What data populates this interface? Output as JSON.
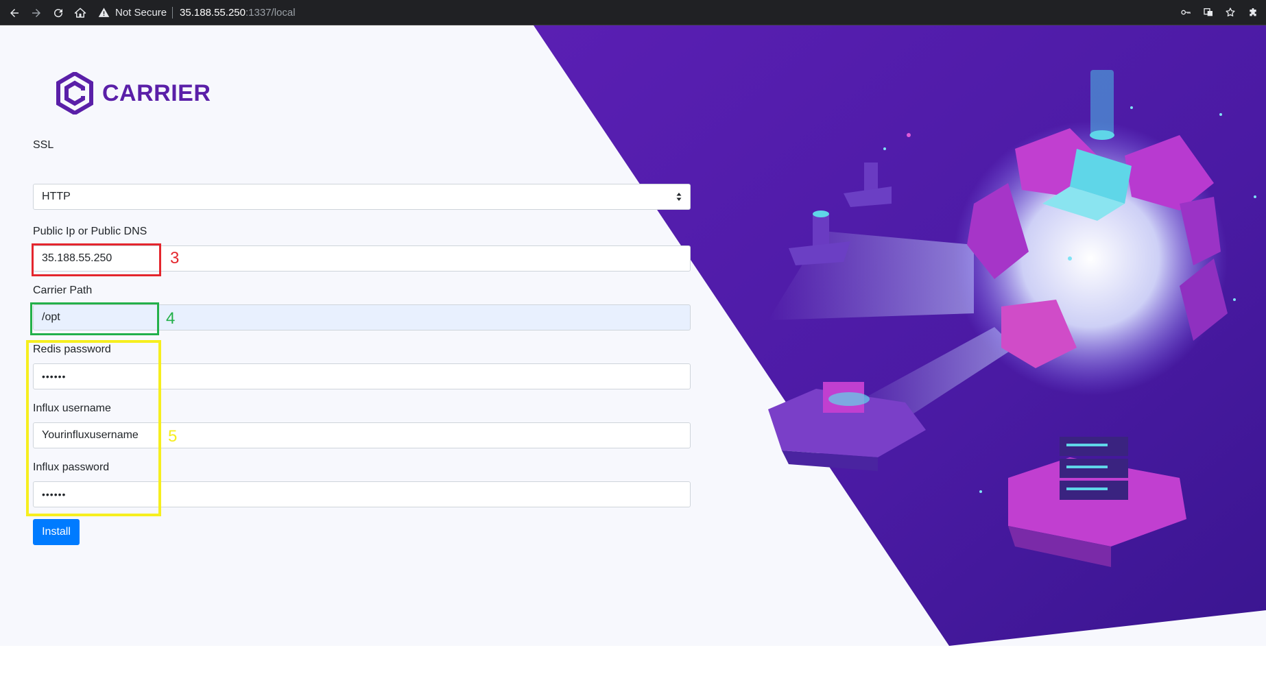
{
  "browser": {
    "not_secure_label": "Not Secure",
    "url_host": "35.188.55.250",
    "url_path": ":1337/local"
  },
  "brand": {
    "name": "CARRIER",
    "color": "#5a1fa8"
  },
  "form": {
    "ssl": {
      "label": "SSL",
      "value": "HTTP"
    },
    "public_ip": {
      "label": "Public Ip or Public DNS",
      "value": "35.188.55.250"
    },
    "carrier_path": {
      "label": "Carrier Path",
      "value": "/opt"
    },
    "redis_password": {
      "label": "Redis password",
      "value": "••••••"
    },
    "influx_username": {
      "label": "Influx username",
      "value": "Yourinfluxusername"
    },
    "influx_password": {
      "label": "Influx password",
      "value": "••••••"
    },
    "install_label": "Install"
  },
  "annotations": [
    {
      "number": "3",
      "color": "#e4262d"
    },
    {
      "number": "4",
      "color": "#23b04a"
    },
    {
      "number": "5",
      "color": "#f6ee1f"
    }
  ],
  "colors": {
    "primary_button": "#007bff",
    "illustration_background": "#4b1aa3"
  }
}
